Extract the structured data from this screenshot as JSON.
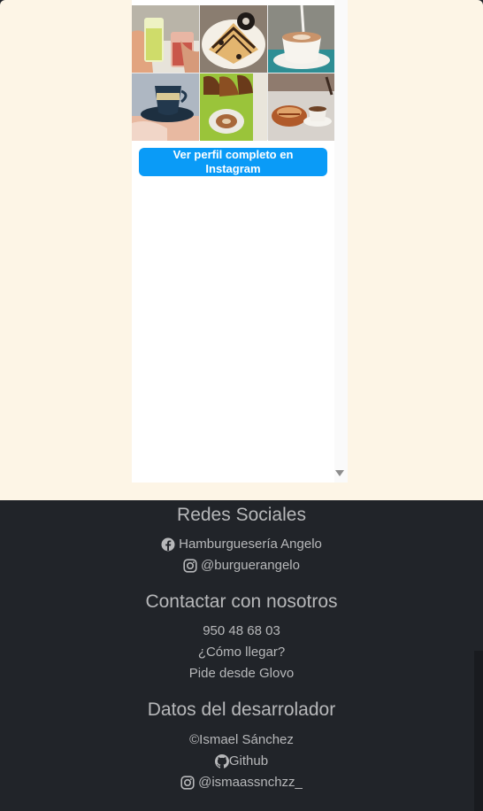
{
  "instagram": {
    "button_label": "Ver perfil completo en Instagram",
    "photos": [
      "drinks-photo",
      "waffle-oreo-photo",
      "latte-photo",
      "coffee-cup-photo",
      "croissants-photo",
      "pastry-photo"
    ]
  },
  "footer": {
    "social": {
      "title": "Redes Sociales",
      "facebook": "Hamburguesería Angelo",
      "instagram": "@burguerangelo"
    },
    "contact": {
      "title": "Contactar con nosotros",
      "phone": "950 48 68 03",
      "directions": "¿Cómo llegar?",
      "delivery": "Pide desde Glovo"
    },
    "developer": {
      "title": "Datos del desarrolador",
      "copyright": "©Ismael Sánchez",
      "github": "Github",
      "instagram": "@ismaassnchzz_"
    }
  },
  "colors": {
    "page_top_bg": "#fdf5e6",
    "footer_bg": "#212429",
    "footer_text": "#b7b8ba",
    "ig_button": "#0a9bf7"
  }
}
